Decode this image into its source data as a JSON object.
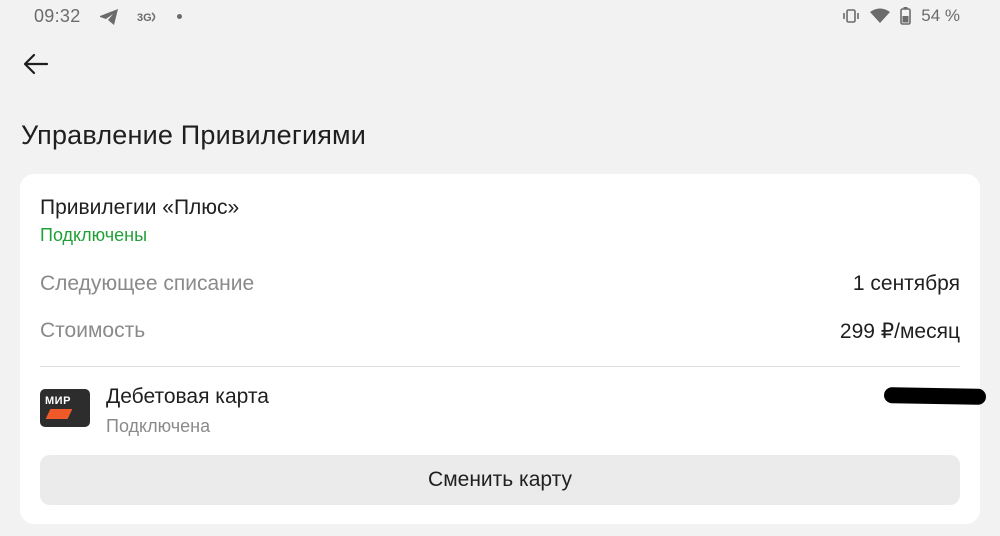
{
  "status_bar": {
    "time": "09:32",
    "left_icons": [
      "telegram-icon",
      "network-3g-icon",
      "dot-icon"
    ],
    "battery": "54 %",
    "right_icons": [
      "vibrate-icon",
      "wifi-icon",
      "battery-icon"
    ]
  },
  "nav": {
    "back_icon": "arrow-left-icon"
  },
  "page": {
    "title": "Управление Привилегиями"
  },
  "subscription": {
    "name": "Привилегии «Плюс»",
    "status": "Подключены",
    "status_color": "#21a038",
    "rows": [
      {
        "label": "Следующее списание",
        "value": "1 сентября"
      },
      {
        "label": "Стоимость",
        "value": "299 ₽/месяц"
      }
    ]
  },
  "payment_card": {
    "logo_text": "МИР",
    "title": "Дебетовая карта",
    "status": "Подключена"
  },
  "actions": {
    "change_card_label": "Сменить карту"
  },
  "colors": {
    "background": "#f2f2f2",
    "card": "#ffffff",
    "accent_green": "#21a038",
    "button_bg": "#ebebeb"
  }
}
